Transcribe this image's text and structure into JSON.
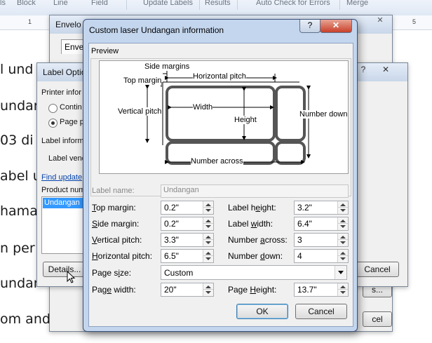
{
  "ribbon": {
    "items": [
      "ls",
      "Block",
      "Line",
      "Field",
      "Update Labels",
      "Results",
      "Auto Check for Errors",
      "Merge"
    ]
  },
  "ruler": {
    "left_num": "1",
    "right_num": "5"
  },
  "document": {
    "lines": [
      "l und",
      "undar",
      "03 di",
      "abel u",
      "hama",
      "n per",
      "undar",
      "om and j"
    ]
  },
  "envelope_dialog": {
    "title": "Envelo",
    "tab": "Envel"
  },
  "label_options_dialog": {
    "title": "Label Optio",
    "printer_info": "Printer infor",
    "radio_continuous": "Contin",
    "radio_page": "Page p",
    "label_info": "Label inform",
    "label_vendors": "Label vend",
    "find_updates": "Find update",
    "product_number": "Product num",
    "product_selected": "Undangan",
    "details_button": "Details...",
    "cancel_button": "Cancel",
    "ellipsis": "s...",
    "cel": "cel"
  },
  "main": {
    "title": "Custom laser Undangan information",
    "help_btn": "?",
    "close_btn": "✕",
    "preview_label": "Preview",
    "diagram": {
      "side_margins": "Side margins",
      "top_margin": "Top margin",
      "horizontal_pitch": "Horizontal pitch",
      "vertical_pitch": "Vertical pitch",
      "width": "Width",
      "height": "Height",
      "number_down": "Number down",
      "number_across": "Number across"
    },
    "label_name_label": "Label name:",
    "label_name_value": "Undangan",
    "fields": {
      "top_margin": {
        "pre": "",
        "ul": "T",
        "post": "op margin:",
        "value": "0.2\""
      },
      "side_margin": {
        "pre": "",
        "ul": "S",
        "post": "ide margin:",
        "value": "0.2\""
      },
      "vertical_pitch": {
        "pre": "",
        "ul": "V",
        "post": "ertical pitch:",
        "value": "3.3\""
      },
      "horizontal_pitch": {
        "pre": "",
        "ul": "H",
        "post": "orizontal pitch:",
        "value": "6.5\""
      },
      "label_height": {
        "pre": "Label h",
        "ul": "e",
        "post": "ight:",
        "value": "3.2\""
      },
      "label_width": {
        "pre": "Label ",
        "ul": "w",
        "post": "idth:",
        "value": "6.4\""
      },
      "number_across": {
        "pre": "Number ",
        "ul": "a",
        "post": "cross:",
        "value": "3"
      },
      "number_down": {
        "pre": "Number ",
        "ul": "d",
        "post": "own:",
        "value": "4"
      },
      "page_width": {
        "pre": "Pag",
        "ul": "e",
        "post": " width:",
        "value": "20\""
      },
      "page_height": {
        "pre": "Page ",
        "ul": "H",
        "post": "eight:",
        "value": "13.7\""
      }
    },
    "page_size_label": {
      "pre": "Page s",
      "ul": "i",
      "post": "ze:"
    },
    "page_size_value": "Custom",
    "ok": "OK",
    "cancel": "Cancel"
  }
}
